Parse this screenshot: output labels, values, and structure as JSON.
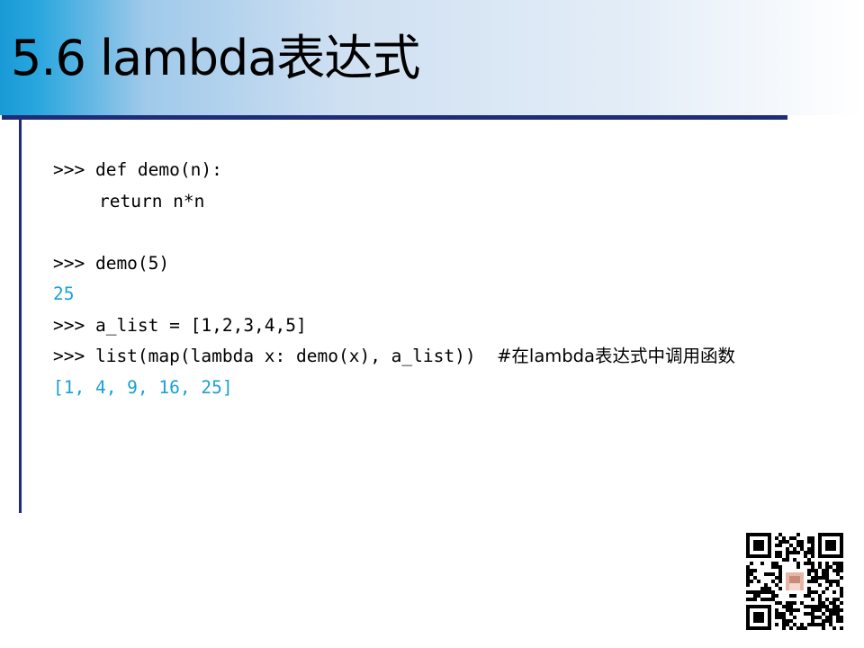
{
  "slide": {
    "title": "5.6 lambda表达式"
  },
  "code": {
    "lines": [
      {
        "kind": "input",
        "text": ">>> def demo(n):"
      },
      {
        "kind": "input",
        "text": "return n*n"
      },
      {
        "kind": "blank",
        "text": ""
      },
      {
        "kind": "input",
        "text": ">>> demo(5)"
      },
      {
        "kind": "output",
        "text": "25"
      },
      {
        "kind": "input",
        "text": ">>> a_list = [1,2,3,4,5]"
      },
      {
        "kind": "input",
        "text": ">>> list(map(lambda x: demo(x), a_list))  "
      },
      {
        "kind": "output",
        "text": "[1, 4, 9, 16, 25]"
      }
    ],
    "comment": "#在lambda表达式中调用函数"
  },
  "colors": {
    "accent_rule": "#1f2c78",
    "output_text": "#1aa0d6",
    "title_band_start": "#1a9ad6",
    "title_band_end": "#ffffff"
  },
  "qr_code": {
    "icon": "qr-code-icon"
  }
}
